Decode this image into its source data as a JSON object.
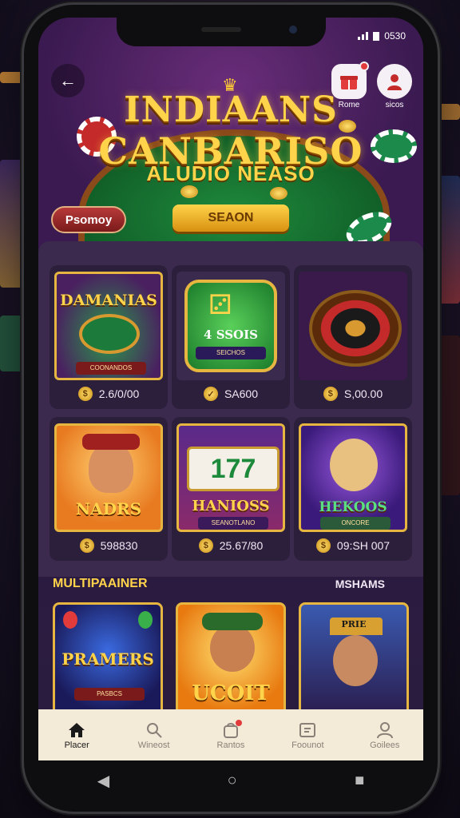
{
  "status": {
    "time": "0530"
  },
  "header": {
    "back_icon": "arrow-left-icon",
    "title_line1": "INDIAANS",
    "title_line2": "CANBARISO",
    "subtitle": "ALUDIO NEASO",
    "promo_pill": "Psomoy",
    "season_button": "SEAON",
    "promo_icon_label": "Rome",
    "user_icon_label": "sicos"
  },
  "games": [
    {
      "title": "DAMANIAS",
      "sub": "COONANDOS",
      "price": "2.6/0/00",
      "coin_glyph": "$",
      "art": "table"
    },
    {
      "title": "4 SSOIS",
      "sub": "SEICHOS",
      "price": "SA600",
      "coin_glyph": "✓",
      "art": "dice"
    },
    {
      "title": "",
      "sub": "",
      "price": "S,00.00",
      "coin_glyph": "$",
      "art": "roulette"
    },
    {
      "title": "NADRS",
      "sub": "",
      "price": "598830",
      "coin_glyph": "$",
      "art": "host"
    },
    {
      "title": "HANIOSS",
      "sub": "SEANOTLANO",
      "reel": "177",
      "price": "25.67/80",
      "coin_glyph": "$",
      "art": "slots"
    },
    {
      "title": "HEKOOS",
      "sub": "ONCORE",
      "price": "09:SH 007",
      "coin_glyph": "$",
      "art": "singer"
    }
  ],
  "multiplayer": {
    "title": "MULTIPAAINER",
    "more": "MSHAMS",
    "cards": [
      {
        "title": "PRAMERS",
        "sub": "PASBCS"
      },
      {
        "title": "UCOIT",
        "sub": ""
      },
      {
        "title": "PRIE",
        "sub": ""
      }
    ]
  },
  "bottom_nav": [
    {
      "label": "Placer",
      "icon": "home-icon",
      "active": true
    },
    {
      "label": "Wineost",
      "icon": "search-icon",
      "active": false
    },
    {
      "label": "Rantos",
      "icon": "bag-icon",
      "active": false,
      "badge": true
    },
    {
      "label": "Foounot",
      "icon": "wallet-icon",
      "active": false
    },
    {
      "label": "Goilees",
      "icon": "user-icon",
      "active": false
    }
  ],
  "colors": {
    "gold": "#ffd34a",
    "panel": "#3b2a4e",
    "card": "#2c1f3c",
    "nav": "#f4ead8"
  }
}
